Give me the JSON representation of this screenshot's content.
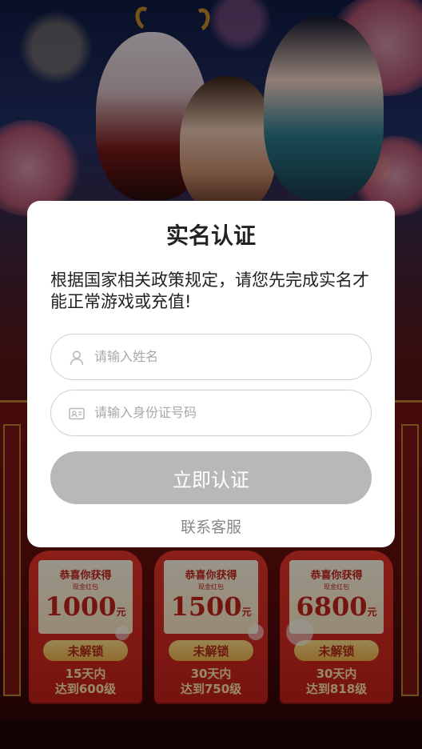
{
  "dialog": {
    "title": "实名认证",
    "message": "根据国家相关政策规定，请您先完成实名才能正常游戏或充值!",
    "name_field": {
      "placeholder": "请输入姓名",
      "value": "",
      "icon": "user-icon"
    },
    "id_field": {
      "placeholder": "请输入身份证号码",
      "value": "",
      "icon": "id-card-icon"
    },
    "submit_label": "立即认证",
    "contact_label": "联系客服"
  },
  "background": {
    "red_packets": [
      {
        "title": "恭喜你获得",
        "subtitle": "现金红包",
        "amount": "1000",
        "unit": "元",
        "status": "未解锁",
        "condition_line1": "15天内",
        "condition_line2": "达到600级"
      },
      {
        "title": "恭喜你获得",
        "subtitle": "现金红包",
        "amount": "1500",
        "unit": "元",
        "status": "未解锁",
        "condition_line1": "30天内",
        "condition_line2": "达到750级"
      },
      {
        "title": "恭喜你获得",
        "subtitle": "现金红包",
        "amount": "6800",
        "unit": "元",
        "status": "未解锁",
        "condition_line1": "30天内",
        "condition_line2": "达到818级"
      }
    ]
  },
  "colors": {
    "dialog_bg": "#ffffff",
    "button_disabled": "#b8b8b8",
    "packet_red": "#e6332a",
    "packet_gold": "#f0b54a"
  }
}
